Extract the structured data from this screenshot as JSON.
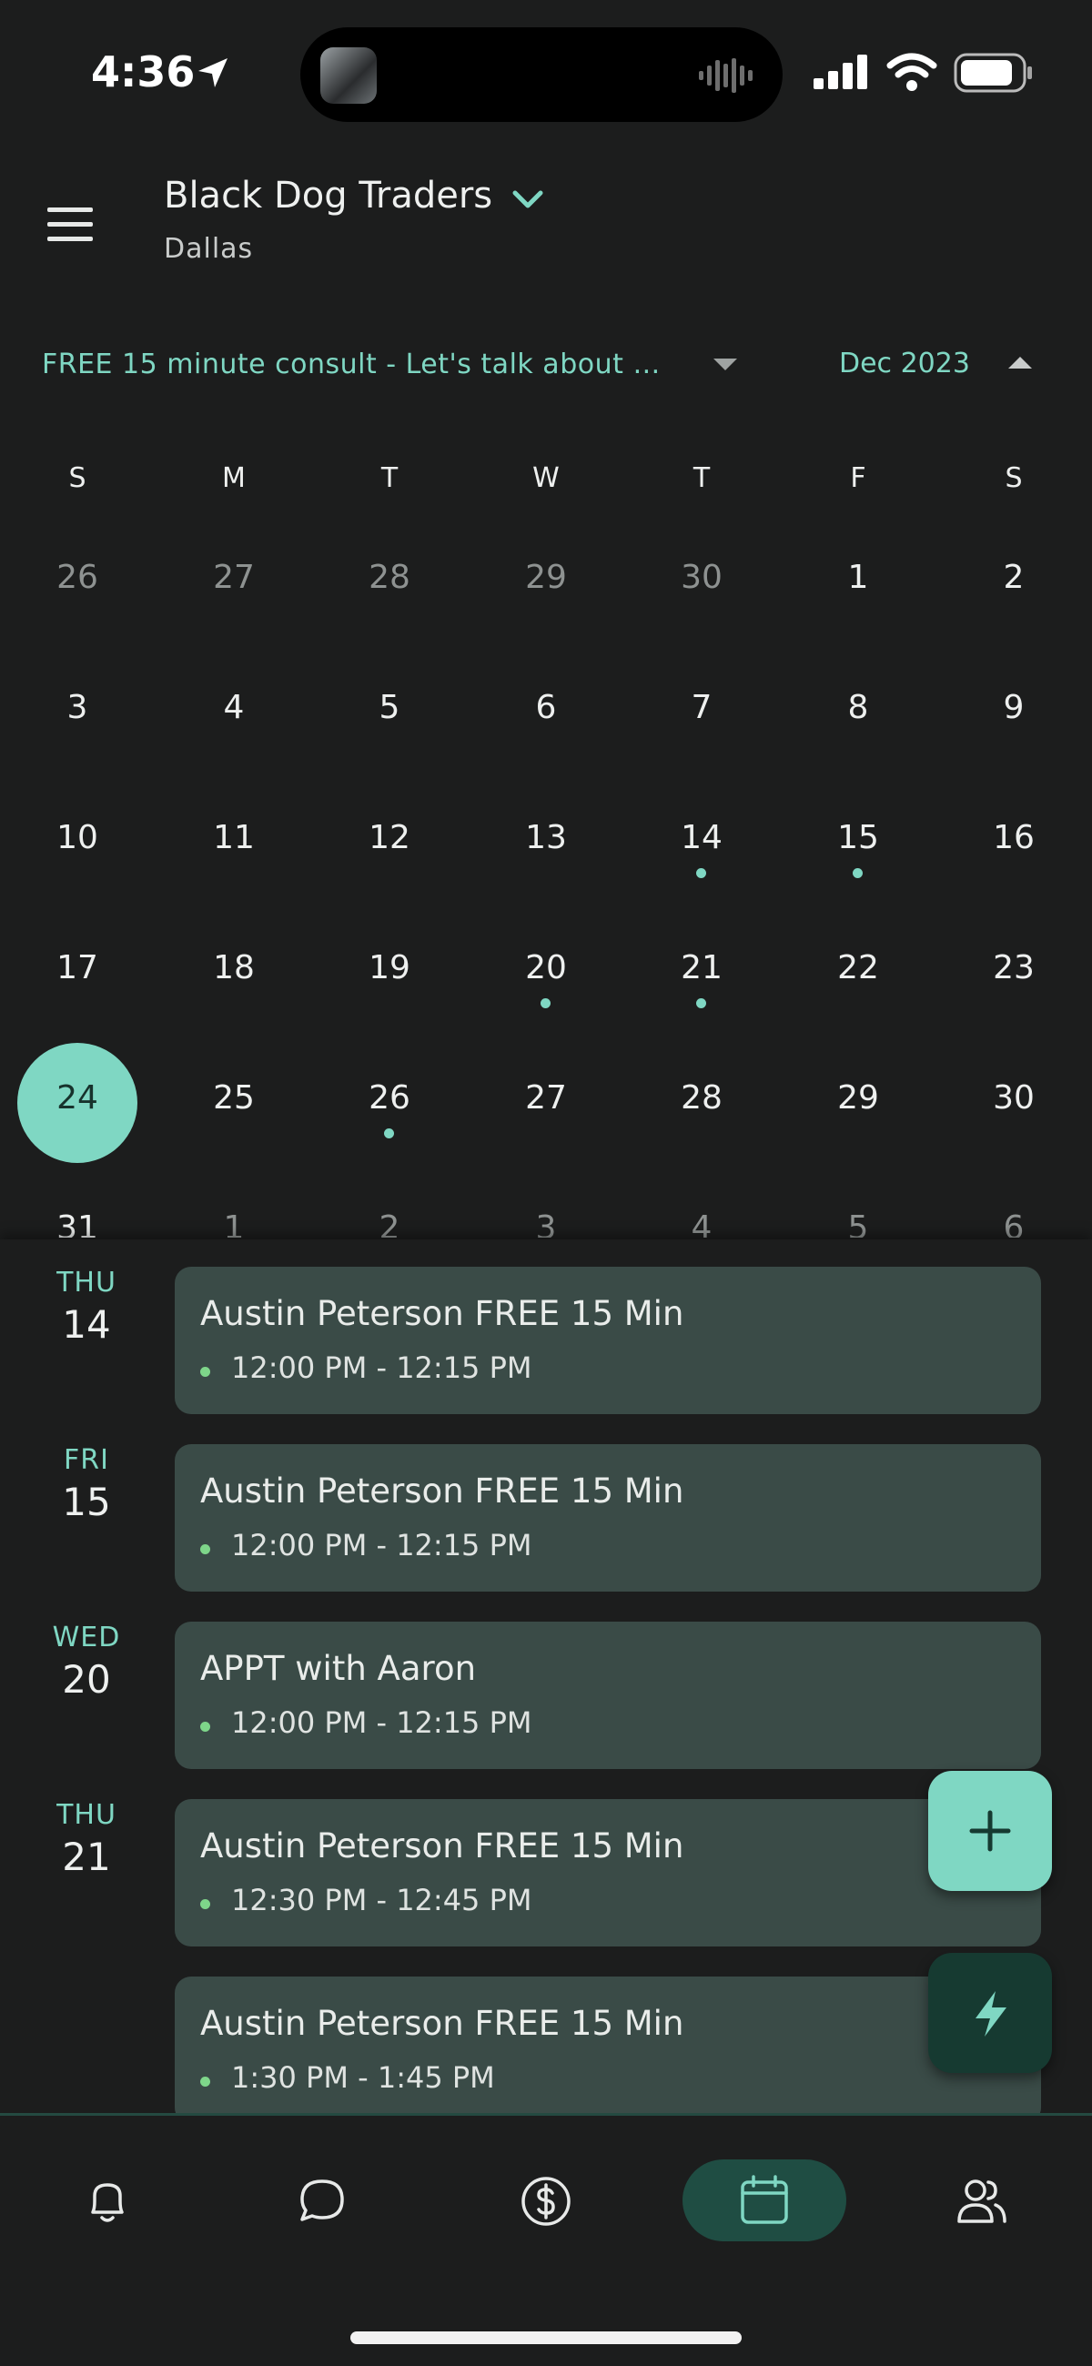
{
  "status_bar": {
    "time": "4:36"
  },
  "header": {
    "business_name": "Black Dog Traders",
    "location": "Dallas"
  },
  "filter": {
    "service": "FREE 15 minute consult - Let's talk about …",
    "month": "Dec 2023"
  },
  "calendar": {
    "weekday_headers": [
      "S",
      "M",
      "T",
      "W",
      "T",
      "F",
      "S"
    ],
    "weeks": [
      [
        {
          "d": "26",
          "dim": true
        },
        {
          "d": "27",
          "dim": true
        },
        {
          "d": "28",
          "dim": true
        },
        {
          "d": "29",
          "dim": true
        },
        {
          "d": "30",
          "dim": true
        },
        {
          "d": "1"
        },
        {
          "d": "2"
        }
      ],
      [
        {
          "d": "3"
        },
        {
          "d": "4"
        },
        {
          "d": "5"
        },
        {
          "d": "6"
        },
        {
          "d": "7"
        },
        {
          "d": "8"
        },
        {
          "d": "9"
        }
      ],
      [
        {
          "d": "10"
        },
        {
          "d": "11"
        },
        {
          "d": "12"
        },
        {
          "d": "13"
        },
        {
          "d": "14",
          "dot": true
        },
        {
          "d": "15",
          "dot": true
        },
        {
          "d": "16"
        }
      ],
      [
        {
          "d": "17"
        },
        {
          "d": "18"
        },
        {
          "d": "19"
        },
        {
          "d": "20",
          "dot": true
        },
        {
          "d": "21",
          "dot": true
        },
        {
          "d": "22"
        },
        {
          "d": "23"
        }
      ],
      [
        {
          "d": "24",
          "selected": true
        },
        {
          "d": "25"
        },
        {
          "d": "26",
          "dot": true
        },
        {
          "d": "27"
        },
        {
          "d": "28"
        },
        {
          "d": "29"
        },
        {
          "d": "30"
        }
      ],
      [
        {
          "d": "31"
        },
        {
          "d": "1",
          "dim": true
        },
        {
          "d": "2",
          "dim": true
        },
        {
          "d": "3",
          "dim": true
        },
        {
          "d": "4",
          "dim": true
        },
        {
          "d": "5",
          "dim": true
        },
        {
          "d": "6",
          "dim": true
        }
      ]
    ]
  },
  "agenda": [
    {
      "dow": "THU",
      "day": "14",
      "title": "Austin Peterson FREE 15 Min",
      "time": "12:00 PM - 12:15 PM"
    },
    {
      "dow": "FRI",
      "day": "15",
      "title": "Austin Peterson FREE 15 Min",
      "time": "12:00 PM - 12:15 PM"
    },
    {
      "dow": "WED",
      "day": "20",
      "title": "APPT with Aaron",
      "time": "12:00 PM - 12:15 PM"
    },
    {
      "dow": "THU",
      "day": "21",
      "title": "Austin Peterson FREE 15 Min",
      "time": "12:30 PM - 12:45 PM"
    },
    {
      "dow": "",
      "day": "",
      "title": "Austin Peterson FREE 15 Min",
      "time": "1:30 PM - 1:45 PM"
    }
  ],
  "bottom_nav": {
    "items": [
      {
        "icon": "bell-icon",
        "active": false
      },
      {
        "icon": "chat-bubble-icon",
        "active": false
      },
      {
        "icon": "dollar-circle-icon",
        "active": false
      },
      {
        "icon": "calendar-icon",
        "active": true
      },
      {
        "icon": "people-icon",
        "active": false
      }
    ]
  },
  "colors": {
    "accent": "#7fd7c3",
    "background": "#1c1d1d",
    "card": "#3a4b47",
    "event_dot": "#7ed68a",
    "nav_active": "#1f4d43"
  }
}
